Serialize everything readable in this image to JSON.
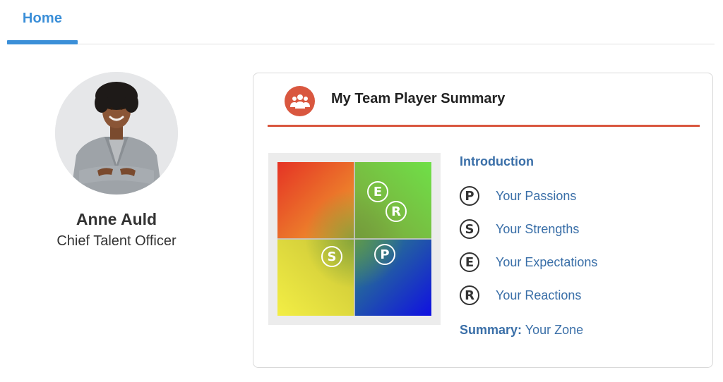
{
  "tabs": {
    "home_label": "Home"
  },
  "profile": {
    "name": "Anne Auld",
    "role": "Chief Talent Officer"
  },
  "card": {
    "title": "My Team Player Summary",
    "icon": "team-group-icon",
    "accent_color": "#d9573f"
  },
  "chart": {
    "markers": [
      {
        "letter": "E",
        "name": "expectations"
      },
      {
        "letter": "R",
        "name": "reactions"
      },
      {
        "letter": "S",
        "name": "strengths"
      },
      {
        "letter": "P",
        "name": "passions"
      }
    ]
  },
  "links": {
    "introduction": "Introduction",
    "items": [
      {
        "letter": "P",
        "label": "Your Passions"
      },
      {
        "letter": "S",
        "label": "Your Strengths"
      },
      {
        "letter": "E",
        "label": "Your Expectations"
      },
      {
        "letter": "R",
        "label": "Your Reactions"
      }
    ],
    "summary_prefix": "Summary:",
    "summary_label": "Your Zone"
  },
  "colors": {
    "tab_blue": "#3b8fd8",
    "link_blue": "#3a6fa8"
  }
}
